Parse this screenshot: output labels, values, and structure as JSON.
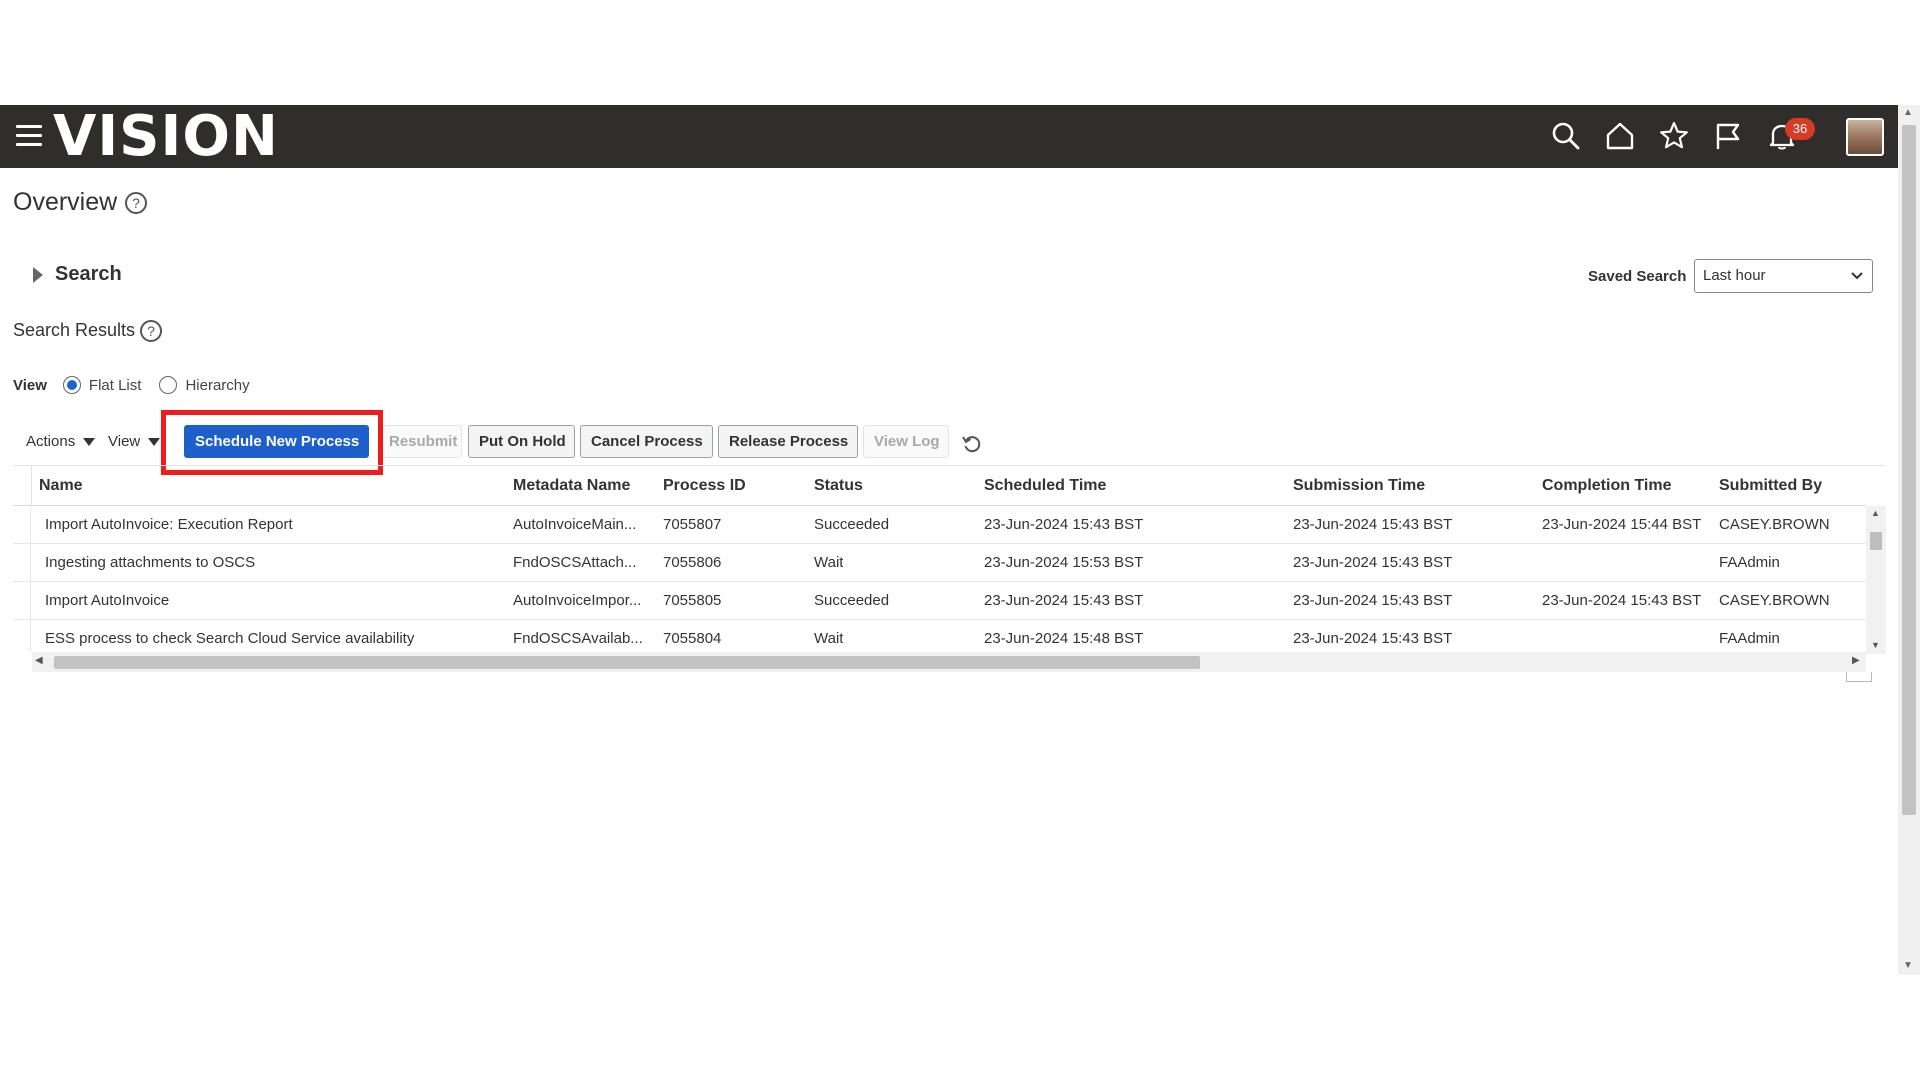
{
  "header": {
    "logo": "VISION",
    "notifications_count": "36"
  },
  "page": {
    "title": "Overview"
  },
  "search": {
    "toggle_label": "Search",
    "saved_search_label": "Saved Search",
    "saved_search_value": "Last hour"
  },
  "results": {
    "title": "Search Results",
    "view_label": "View",
    "view_options": [
      "Flat List",
      "Hierarchy"
    ],
    "selected_view": "Flat List"
  },
  "toolbar": {
    "actions": "Actions",
    "view": "View",
    "schedule_new_process": "Schedule New Process",
    "resubmit": "Resubmit",
    "put_on_hold": "Put On Hold",
    "cancel_process": "Cancel Process",
    "release_process": "Release Process",
    "view_log": "View Log"
  },
  "table": {
    "columns": [
      "Name",
      "Metadata Name",
      "Process ID",
      "Status",
      "Scheduled Time",
      "Submission Time",
      "Completion Time",
      "Submitted By"
    ],
    "rows": [
      {
        "name": "Import AutoInvoice: Execution Report",
        "metadata": "AutoInvoiceMain...",
        "process_id": "7055807",
        "status": "Succeeded",
        "scheduled": "23-Jun-2024 15:43 BST",
        "submission": "23-Jun-2024 15:43 BST",
        "completion": "23-Jun-2024 15:44 BST",
        "submitted_by": "CASEY.BROWN"
      },
      {
        "name": "Ingesting attachments to OSCS",
        "metadata": "FndOSCSAttach...",
        "process_id": "7055806",
        "status": "Wait",
        "scheduled": "23-Jun-2024 15:53 BST",
        "submission": "23-Jun-2024 15:43 BST",
        "completion": "",
        "submitted_by": "FAAdmin"
      },
      {
        "name": "Import AutoInvoice",
        "metadata": "AutoInvoiceImpor...",
        "process_id": "7055805",
        "status": "Succeeded",
        "scheduled": "23-Jun-2024 15:43 BST",
        "submission": "23-Jun-2024 15:43 BST",
        "completion": "23-Jun-2024 15:43 BST",
        "submitted_by": "CASEY.BROWN"
      },
      {
        "name": "ESS process to check Search Cloud Service availability",
        "metadata": "FndOSCSAvailab...",
        "process_id": "7055804",
        "status": "Wait",
        "scheduled": "23-Jun-2024 15:48 BST",
        "submission": "23-Jun-2024 15:43 BST",
        "completion": "",
        "submitted_by": "FAAdmin"
      }
    ]
  },
  "colors": {
    "header_bg": "#312d2a",
    "primary_button": "#1f5fcb",
    "highlight": "#ee1c1c",
    "badge": "#d63b25"
  }
}
